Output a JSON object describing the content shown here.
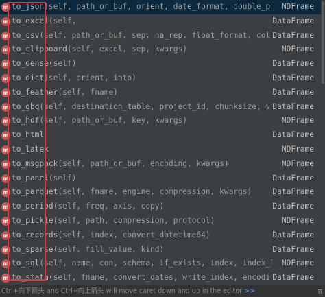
{
  "completion": {
    "items": [
      {
        "name": "to_json",
        "params": "(self, path_or_buf, orient, date_format, double_precisi",
        "type": "NDFrame",
        "marker": "m"
      },
      {
        "name": "to_excel",
        "params": "(self,",
        "type": "DataFrame",
        "marker": "m"
      },
      {
        "name": "to_csv",
        "params": "(self, path_or_buf, sep, na_rep, float_format, columns",
        "type": "DataFrame",
        "marker": "m"
      },
      {
        "name": "to_clipboard",
        "params": "(self, excel, sep, kwargs)",
        "type": "NDFrame",
        "marker": "m"
      },
      {
        "name": "to_dense",
        "params": "(self)",
        "type": "DataFrame",
        "marker": "m"
      },
      {
        "name": "to_dict",
        "params": "(self, orient, into)",
        "type": "DataFrame",
        "marker": "m"
      },
      {
        "name": "to_feather",
        "params": "(self, fname)",
        "type": "DataFrame",
        "marker": "m"
      },
      {
        "name": "to_gbq",
        "params": "(self, destination_table, project_id, chunksize, verbo",
        "type": "DataFrame",
        "marker": "m"
      },
      {
        "name": "to_hdf",
        "params": "(self, path_or_buf, key, kwargs)",
        "type": "NDFrame",
        "marker": "m"
      },
      {
        "name": "to_html",
        "params": "",
        "type": "DataFrame",
        "marker": "m"
      },
      {
        "name": "to_latex",
        "params": "",
        "type": "NDFrame",
        "marker": "m"
      },
      {
        "name": "to_msgpack",
        "params": "(self, path_or_buf, encoding, kwargs)",
        "type": "NDFrame",
        "marker": "m"
      },
      {
        "name": "to_panel",
        "params": "(self)",
        "type": "DataFrame",
        "marker": "m"
      },
      {
        "name": "to_parquet",
        "params": "(self, fname, engine, compression, kwargs)",
        "type": "DataFrame",
        "marker": "m"
      },
      {
        "name": "to_period",
        "params": "(self, freq, axis, copy)",
        "type": "DataFrame",
        "marker": "m"
      },
      {
        "name": "to_pickle",
        "params": "(self, path, compression, protocol)",
        "type": "NDFrame",
        "marker": "m"
      },
      {
        "name": "to_records",
        "params": "(self, index, convert_datetime64)",
        "type": "DataFrame",
        "marker": "m"
      },
      {
        "name": "to_sparse",
        "params": "(self, fill_value, kind)",
        "type": "DataFrame",
        "marker": "m"
      },
      {
        "name": "to_sql",
        "params": "(self, name, con, schema, if_exists, index, index_label,",
        "type": "NDFrame",
        "marker": "m"
      },
      {
        "name": "to_stata",
        "params": "(self, fname, convert_dates, write_index, encoding,",
        "type": "DataFrame",
        "marker": "m"
      }
    ],
    "selected_index": 0
  },
  "status_bar": {
    "text": "Ctrl+向下箭头 and Ctrl+向上箭头 will move caret down and up in the editor",
    "arrows": ">>",
    "pi_symbol": "π"
  },
  "colors": {
    "background": "#3c3f41",
    "selected_row": "#0d293e",
    "method_marker": "#c75450",
    "highlight_box": "#e0393e"
  }
}
